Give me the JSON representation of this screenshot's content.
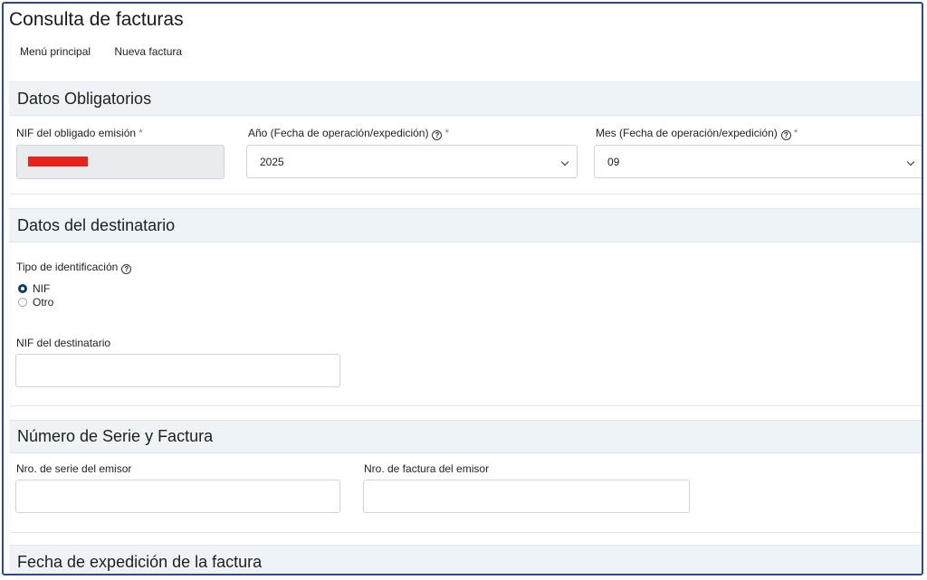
{
  "page": {
    "title": "Consulta de facturas"
  },
  "nav": {
    "items": [
      "Menú principal",
      "Nueva factura"
    ]
  },
  "sections": {
    "obligatorios": {
      "title": "Datos Obligatorios",
      "nif_label": "NIF del obligado emisión",
      "anio_label": "Año (Fecha de operación/expedición)",
      "anio_value": "2025",
      "mes_label": "Mes (Fecha de operación/expedición)",
      "mes_value": "09",
      "required_mark": "*"
    },
    "destinatario": {
      "title": "Datos del destinatario",
      "tipo_label": "Tipo de identificación",
      "options": [
        "NIF",
        "Otro"
      ],
      "selected": "NIF",
      "nif_label": "NIF del destinatario",
      "nif_value": ""
    },
    "serie": {
      "title": "Número de Serie y Factura",
      "serie_label": "Nro. de serie del emisor",
      "serie_value": "",
      "factura_label": "Nro. de factura del emisor",
      "factura_value": ""
    },
    "fecha": {
      "title": "Fecha de expedición de la factura"
    }
  },
  "icons": {
    "help": "help-circle-icon",
    "dropdown": "chevron-down-icon"
  },
  "colors": {
    "frame_border": "#2c4a8a",
    "section_bg": "#eef3f7",
    "redaction": "#e8231c",
    "radio_checked": "#0d3b66"
  }
}
